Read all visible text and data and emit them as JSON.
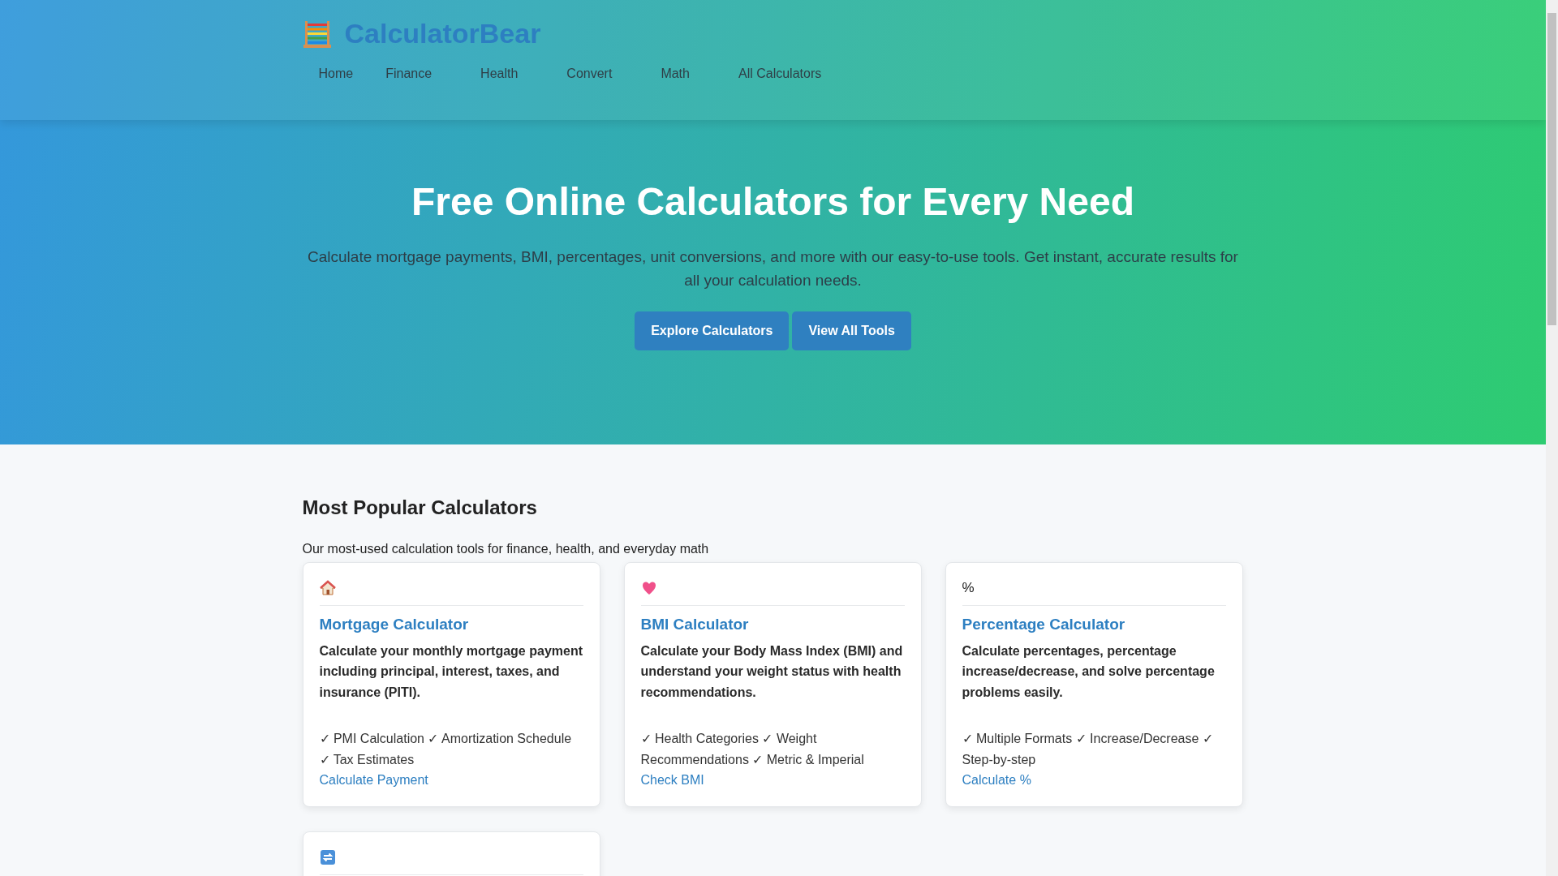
{
  "header": {
    "logo_text": "CalculatorBear",
    "nav": [
      {
        "label": "Home"
      },
      {
        "label": "Finance"
      },
      {
        "label": "Health"
      },
      {
        "label": "Convert"
      },
      {
        "label": "Math"
      },
      {
        "label": "All Calculators"
      }
    ]
  },
  "hero": {
    "title": "Free Online Calculators for Every Need",
    "text": "Calculate mortgage payments, BMI, percentages, unit conversions, and more with our easy-to-use tools. Get instant, accurate results for all your calculation needs.",
    "buttons": [
      "Explore Calculators",
      "View All Tools"
    ]
  },
  "popular": {
    "title": "Most Popular Calculators",
    "subtitle": "Our most-used calculation tools for finance, health, and everyday math",
    "cards": [
      {
        "kind": "icon",
        "title": "Mortgage Calculator",
        "description": "Calculate your monthly mortgage payment including principal, interest, taxes, and insurance (PITI).",
        "features": "✓ PMI Calculation ✓ Amortization Schedule ✓ Tax Estimates",
        "link": "Calculate Payment"
      },
      {
        "kind": "icon",
        "title": "BMI Calculator",
        "description": "Calculate your Body Mass Index (BMI) and understand your weight status with health recommendations.",
        "features": "✓ Health Categories ✓ Weight Recommendations ✓ Metric & Imperial",
        "link": "Check BMI"
      },
      {
        "kind": "symbol",
        "symbol": "%",
        "title": "Percentage Calculator",
        "description": "Calculate percentages, percentage increase/decrease, and solve percentage problems easily.",
        "features": "✓ Multiple Formats ✓ Increase/Decrease ✓ Step-by-step",
        "link": "Calculate %"
      },
      {
        "kind": "icon"
      }
    ]
  }
}
